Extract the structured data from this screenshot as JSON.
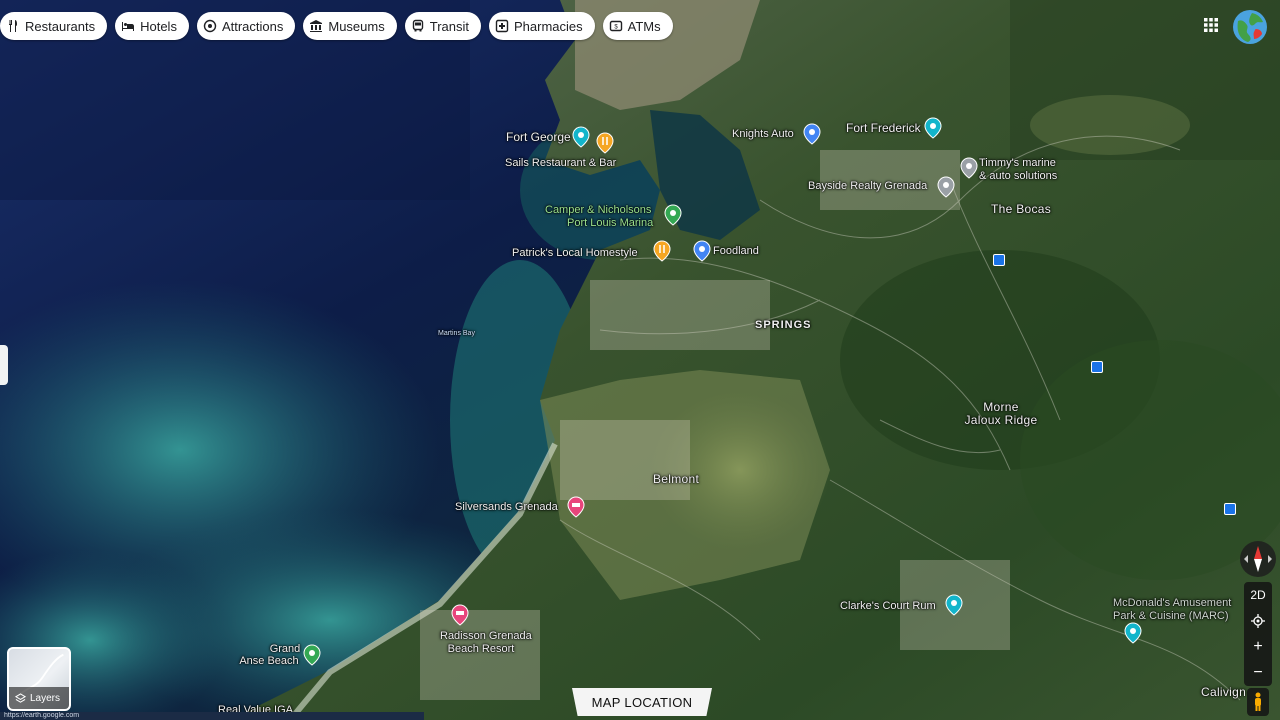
{
  "chips": [
    {
      "label": "Restaurants",
      "icon": "fork-knife-icon"
    },
    {
      "label": "Hotels",
      "icon": "bed-icon"
    },
    {
      "label": "Attractions",
      "icon": "camera-icon"
    },
    {
      "label": "Museums",
      "icon": "museum-icon"
    },
    {
      "label": "Transit",
      "icon": "bus-icon"
    },
    {
      "label": "Pharmacies",
      "icon": "pharmacy-icon"
    },
    {
      "label": "ATMs",
      "icon": "atm-icon"
    }
  ],
  "map": {
    "view": "satellite",
    "colors": {
      "teal_pin": "#12b5cb",
      "orange_pin": "#f5a623",
      "blue_pin": "#4285f4",
      "pink_pin": "#e8457c",
      "green_pin": "#34a853",
      "gray_pin": "#9aa0a6"
    },
    "labels": {
      "fort_george": "Fort George",
      "sails": "Sails Restaurant & Bar",
      "knights_auto": "Knights Auto",
      "fort_frederick": "Fort Frederick",
      "timmys_1": "Timmy's marine",
      "timmys_2": "& auto solutions",
      "bayside": "Bayside Realty Grenada",
      "the_bocas": "The Bocas",
      "camper_1": "Camper & Nicholsons",
      "camper_2": "Port Louis Marina",
      "patricks": "Patrick's Local Homestyle",
      "foodland": "Foodland",
      "springs": "SPRINGS",
      "martins_bay": "Martins Bay",
      "morne_1": "Morne",
      "morne_2": "Jaloux Ridge",
      "belmont": "Belmont",
      "silversands": "Silversands Grenada",
      "clarkes": "Clarke's Court Rum",
      "mcdonalds_1": "McDonald's Amusement",
      "mcdonalds_2": "Park & Cuisine (MARC)",
      "radisson_1": "Radisson Grenada",
      "radisson_2": "Beach Resort",
      "grand_anse_1": "Grand",
      "grand_anse_2": "Anse Beach",
      "calivigny": "Calivign",
      "real_value": "Real Value IGA"
    }
  },
  "controls": {
    "view_toggle": "2D",
    "zoom_in": "+",
    "zoom_out": "−"
  },
  "layers": {
    "label": "Layers"
  },
  "status_url": "https://earth.google.com",
  "caption": "MAP LOCATION"
}
